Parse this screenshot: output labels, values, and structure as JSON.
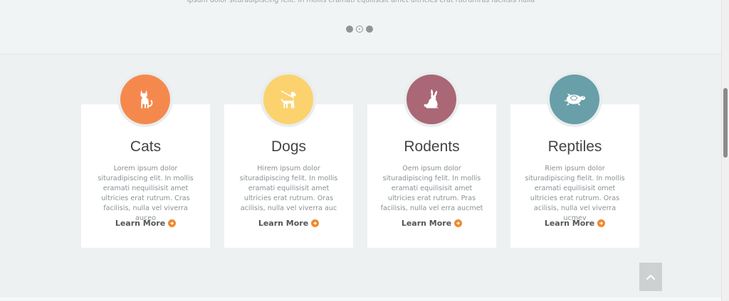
{
  "slider": {
    "caption": "Ipsum dolor situradipiscing felit. In mollis eramati equilisisit amet ultricies erat rutrumras facilisis nulla",
    "dots": [
      "dot-1",
      "dot-2",
      "dot-3"
    ],
    "active_dot": 1
  },
  "cards": [
    {
      "title": "Cats",
      "text": "Lorem ipsum dolor situradipiscing elit. In mollis eramati nequilisisit amet ultricies erat rutrum. Cras facilisis, nulla vel viverra auceo",
      "link": "Learn More",
      "icon": "cat-icon",
      "color": "#f5894d"
    },
    {
      "title": "Dogs",
      "text": "Hirem ipsum dolor situradipiscing felit. In mollis eramati equilisisit amet ultricies erat rutrum. Oras acilisis, nulla vel viverra auc",
      "link": "Learn More",
      "icon": "dog-icon",
      "color": "#fbd26d"
    },
    {
      "title": "Rodents",
      "text": "Oem ipsum dolor situradipiscing felit. In mollis eramati equilisisit amet ultricies erat rutrum. Pras facilisis, nulla vel erra aucmet",
      "link": "Learn More",
      "icon": "rabbit-icon",
      "color": "#aa6776"
    },
    {
      "title": "Reptiles",
      "text": "Riem ipsum dolor situradipiscing fielit. In mollis eramati equilisisit omet ultricies erat rutrum. Oras acilisis, nulla vel viverra ucmev",
      "link": "Learn More",
      "icon": "turtle-icon",
      "color": "#689fa9"
    }
  ],
  "accent_color": "#ef8a2c",
  "scroll_top": {
    "icon": "chevron-up-icon"
  }
}
